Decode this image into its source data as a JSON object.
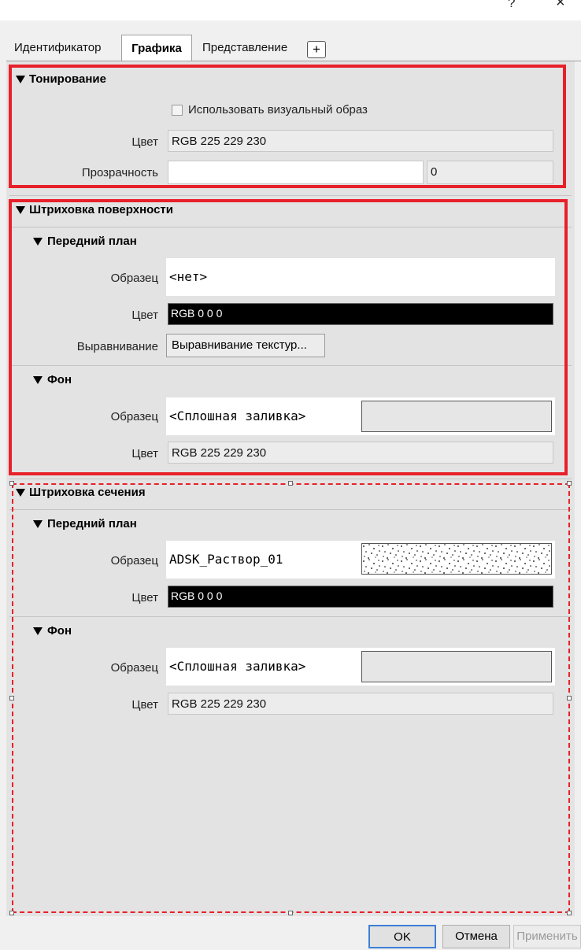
{
  "titlebar": {
    "help_glyph": "?",
    "close_glyph": "×"
  },
  "tabs": {
    "items": [
      "Идентификатор",
      "Графика",
      "Представление"
    ],
    "add_label": "+"
  },
  "toning": {
    "title": "Тонирование",
    "use_visual_label": "Использовать визуальный образ",
    "color_label": "Цвет",
    "color_value": "RGB 225 229 230",
    "transparency_label": "Прозрачность",
    "transparency_value": "0"
  },
  "surface_hatch": {
    "title": "Штриховка поверхности",
    "foreground": {
      "title": "Передний план",
      "pattern_label": "Образец",
      "pattern_value": "<нет>",
      "color_label": "Цвет",
      "color_value": "RGB 0 0 0",
      "align_label": "Выравнивание",
      "align_button": "Выравнивание текстур..."
    },
    "background": {
      "title": "Фон",
      "pattern_label": "Образец",
      "pattern_value": "<Сплошная заливка>",
      "color_label": "Цвет",
      "color_value": "RGB 225 229 230"
    }
  },
  "cut_hatch": {
    "title": "Штриховка сечения",
    "foreground": {
      "title": "Передний план",
      "pattern_label": "Образец",
      "pattern_value": "ADSK_Раствор_01",
      "color_label": "Цвет",
      "color_value": "RGB 0 0 0"
    },
    "background": {
      "title": "Фон",
      "pattern_label": "Образец",
      "pattern_value": "<Сплошная заливка>",
      "color_label": "Цвет",
      "color_value": "RGB 225 229 230"
    }
  },
  "footer": {
    "ok": "OK",
    "cancel": "Отмена",
    "apply": "Применить"
  },
  "colors": {
    "highlight": "#e8202a",
    "panel": "#e3e3e3",
    "field": "#ececec",
    "black_field": "#000000"
  }
}
